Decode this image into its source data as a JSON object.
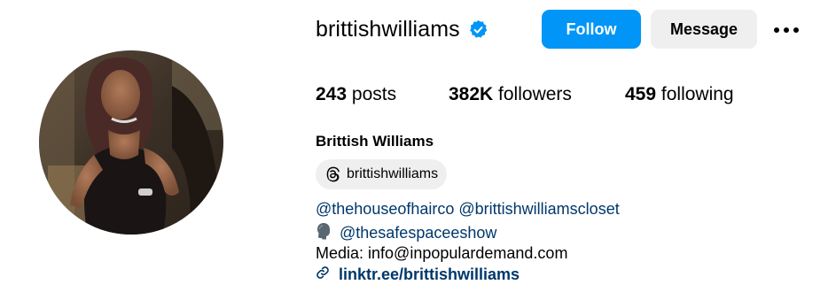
{
  "profile": {
    "username": "brittishwilliams",
    "full_name": "Brittish Williams",
    "verified": true,
    "accent_color": "#0095f6",
    "link_color": "#00376b"
  },
  "actions": {
    "follow_label": "Follow",
    "message_label": "Message",
    "more_icon": "more-options-icon"
  },
  "stats": {
    "posts_count": "243",
    "posts_label": "posts",
    "followers_count": "382K",
    "followers_label": "followers",
    "following_count": "459",
    "following_label": "following"
  },
  "threads": {
    "icon": "threads-icon",
    "handle": "brittishwilliams"
  },
  "bio": {
    "mention_1": "@thehouseofhairco",
    "mention_2": "@brittishwilliamscloset",
    "podcast_icon": "speaking-head-icon",
    "mention_3": "@thesafespaceeshow",
    "media_line": "Media: info@inpopulardemand.com",
    "link_icon": "link-icon",
    "link_text": "linktr.ee/brittishwilliams"
  }
}
